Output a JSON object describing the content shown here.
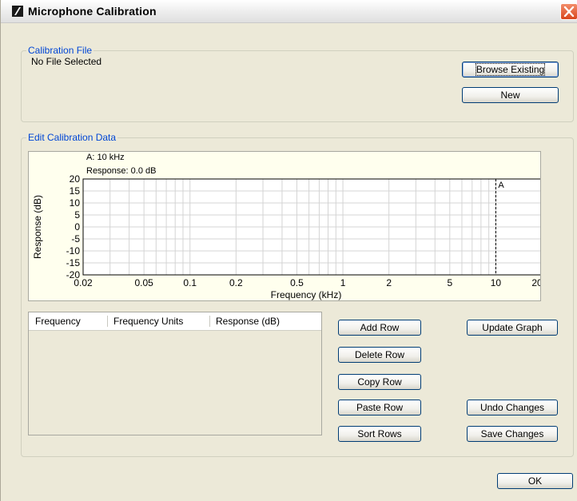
{
  "window": {
    "title": "Microphone Calibration"
  },
  "calibration_file": {
    "legend": "Calibration File",
    "status": "No File Selected",
    "browse_label": "Browse Existing",
    "new_label": "New"
  },
  "edit_data": {
    "legend": "Edit Calibration Data",
    "marker_line1": "A: 10 kHz",
    "marker_line2": "Response: 0.0  dB"
  },
  "chart_data": {
    "type": "line",
    "xlabel": "Frequency (kHz)",
    "ylabel": "Response (dB)",
    "xscale": "log",
    "xlim": [
      0.02,
      20
    ],
    "ylim": [
      -20,
      20
    ],
    "x_ticks": [
      0.02,
      0.05,
      0.1,
      0.2,
      0.5,
      1,
      2,
      5,
      10,
      20
    ],
    "x_tick_labels": [
      "0.02",
      "0.05",
      "0.1",
      "0.2",
      "0.5",
      "1",
      "2",
      "5",
      "10",
      "20"
    ],
    "y_ticks": [
      20,
      15,
      10,
      5,
      0,
      -5,
      -10,
      -15,
      -20
    ],
    "y_tick_labels": [
      "20",
      "15",
      "10",
      "5",
      "0",
      "-5",
      "-10",
      "-15",
      "-20"
    ],
    "grid": true,
    "series": [],
    "marker": {
      "label": "A",
      "x": 10,
      "y": 0.0
    }
  },
  "table": {
    "columns": [
      "Frequency",
      "Frequency Units",
      "Response (dB)"
    ],
    "rows": []
  },
  "buttons": {
    "add_row": "Add Row",
    "delete_row": "Delete Row",
    "copy_row": "Copy Row",
    "paste_row": "Paste Row",
    "sort_rows": "Sort Rows",
    "update_graph": "Update Graph",
    "undo_changes": "Undo Changes",
    "save_changes": "Save Changes",
    "ok": "OK"
  },
  "colors": {
    "legend_text": "#0046d5",
    "chart_background": "#ffffee",
    "close_button": "#d9461d"
  }
}
